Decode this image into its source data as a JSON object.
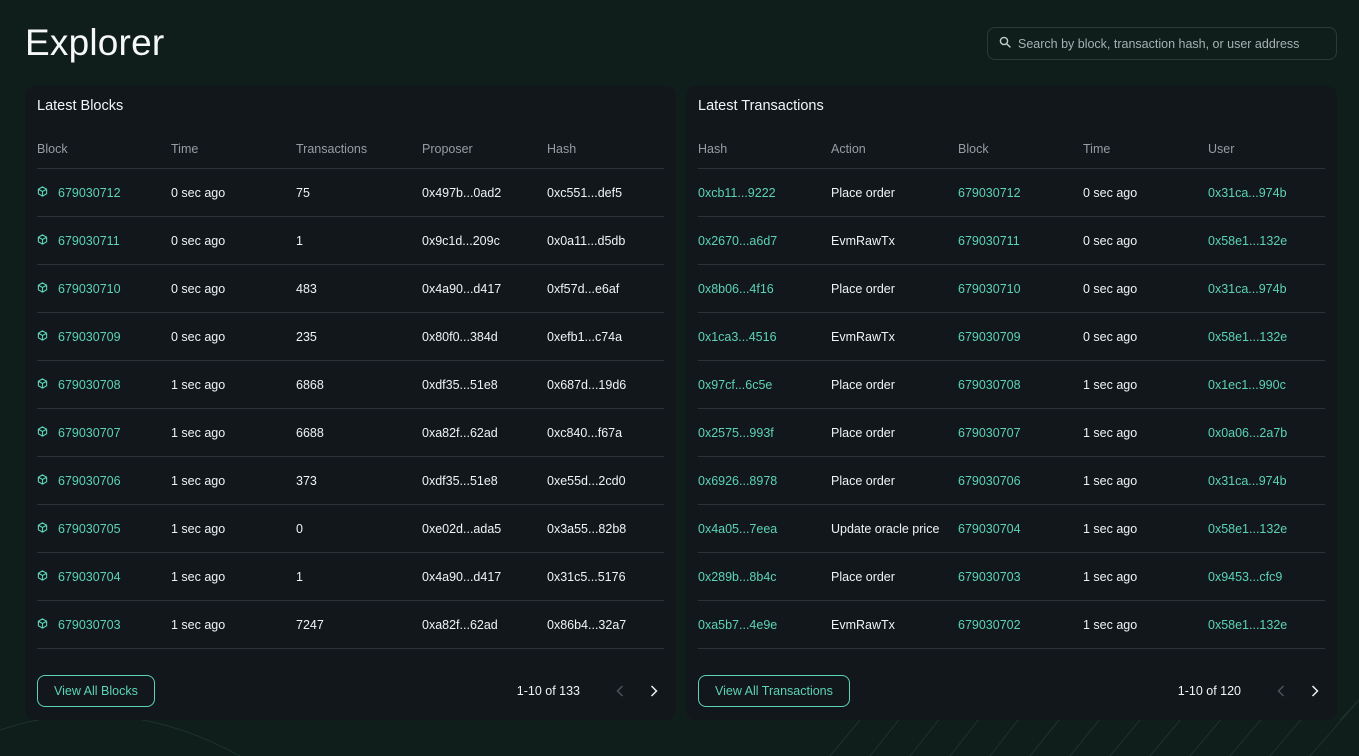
{
  "page": {
    "title": "Explorer"
  },
  "search": {
    "placeholder": "Search by block, transaction hash, or user address"
  },
  "colors": {
    "accent": "#5cd3b7",
    "background": "#0f1e1a",
    "panel": "#12171c"
  },
  "blocks": {
    "title": "Latest Blocks",
    "columns": [
      "Block",
      "Time",
      "Transactions",
      "Proposer",
      "Hash"
    ],
    "rows": [
      {
        "block": "679030712",
        "time": "0 sec ago",
        "transactions": "75",
        "proposer": "0x497b...0ad2",
        "hash": "0xc551...def5"
      },
      {
        "block": "679030711",
        "time": "0 sec ago",
        "transactions": "1",
        "proposer": "0x9c1d...209c",
        "hash": "0x0a11...d5db"
      },
      {
        "block": "679030710",
        "time": "0 sec ago",
        "transactions": "483",
        "proposer": "0x4a90...d417",
        "hash": "0xf57d...e6af"
      },
      {
        "block": "679030709",
        "time": "0 sec ago",
        "transactions": "235",
        "proposer": "0x80f0...384d",
        "hash": "0xefb1...c74a"
      },
      {
        "block": "679030708",
        "time": "1 sec ago",
        "transactions": "6868",
        "proposer": "0xdf35...51e8",
        "hash": "0x687d...19d6"
      },
      {
        "block": "679030707",
        "time": "1 sec ago",
        "transactions": "6688",
        "proposer": "0xa82f...62ad",
        "hash": "0xc840...f67a"
      },
      {
        "block": "679030706",
        "time": "1 sec ago",
        "transactions": "373",
        "proposer": "0xdf35...51e8",
        "hash": "0xe55d...2cd0"
      },
      {
        "block": "679030705",
        "time": "1 sec ago",
        "transactions": "0",
        "proposer": "0xe02d...ada5",
        "hash": "0x3a55...82b8"
      },
      {
        "block": "679030704",
        "time": "1 sec ago",
        "transactions": "1",
        "proposer": "0x4a90...d417",
        "hash": "0x31c5...5176"
      },
      {
        "block": "679030703",
        "time": "1 sec ago",
        "transactions": "7247",
        "proposer": "0xa82f...62ad",
        "hash": "0x86b4...32a7"
      }
    ],
    "view_all_label": "View All Blocks",
    "pagination": "1-10 of 133"
  },
  "transactions": {
    "title": "Latest Transactions",
    "columns": [
      "Hash",
      "Action",
      "Block",
      "Time",
      "User"
    ],
    "rows": [
      {
        "hash": "0xcb11...9222",
        "action": "Place order",
        "block": "679030712",
        "time": "0 sec ago",
        "user": "0x31ca...974b"
      },
      {
        "hash": "0x2670...a6d7",
        "action": "EvmRawTx",
        "block": "679030711",
        "time": "0 sec ago",
        "user": "0x58e1...132e"
      },
      {
        "hash": "0x8b06...4f16",
        "action": "Place order",
        "block": "679030710",
        "time": "0 sec ago",
        "user": "0x31ca...974b"
      },
      {
        "hash": "0x1ca3...4516",
        "action": "EvmRawTx",
        "block": "679030709",
        "time": "0 sec ago",
        "user": "0x58e1...132e"
      },
      {
        "hash": "0x97cf...6c5e",
        "action": "Place order",
        "block": "679030708",
        "time": "1 sec ago",
        "user": "0x1ec1...990c"
      },
      {
        "hash": "0x2575...993f",
        "action": "Place order",
        "block": "679030707",
        "time": "1 sec ago",
        "user": "0x0a06...2a7b"
      },
      {
        "hash": "0x6926...8978",
        "action": "Place order",
        "block": "679030706",
        "time": "1 sec ago",
        "user": "0x31ca...974b"
      },
      {
        "hash": "0x4a05...7eea",
        "action": "Update oracle price",
        "block": "679030704",
        "time": "1 sec ago",
        "user": "0x58e1...132e"
      },
      {
        "hash": "0x289b...8b4c",
        "action": "Place order",
        "block": "679030703",
        "time": "1 sec ago",
        "user": "0x9453...cfc9"
      },
      {
        "hash": "0xa5b7...4e9e",
        "action": "EvmRawTx",
        "block": "679030702",
        "time": "1 sec ago",
        "user": "0x58e1...132e"
      }
    ],
    "view_all_label": "View All Transactions",
    "pagination": "1-10 of 120"
  },
  "icons": {
    "search": "search-icon",
    "block": "cube-icon",
    "prev": "chevron-left-icon",
    "next": "chevron-right-icon"
  }
}
